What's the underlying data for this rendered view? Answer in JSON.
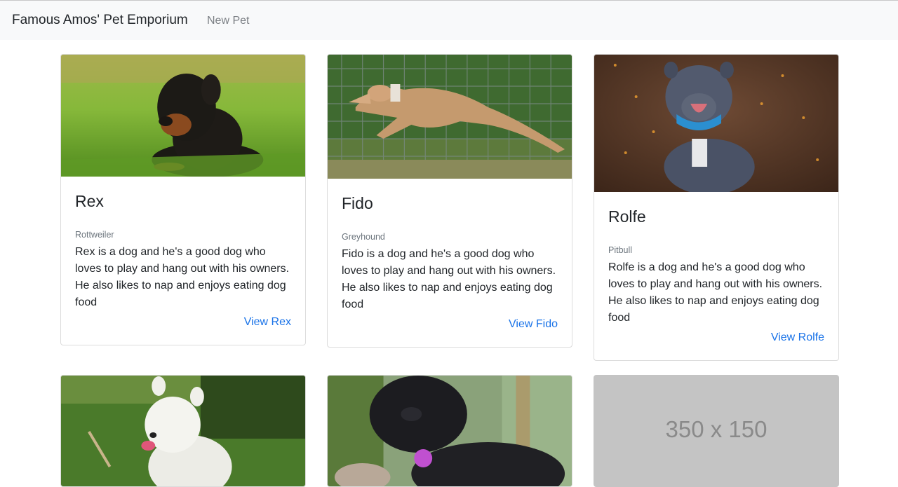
{
  "navbar": {
    "brand": "Famous Amos' Pet Emporium",
    "links": [
      "New Pet"
    ]
  },
  "pets": [
    {
      "name": "Rex",
      "breed": "Rottweiler",
      "description": "Rex is a dog and he's a good dog who loves to play and hang out with his owners. He also likes to nap and enjoys eating dog food",
      "link": "View Rex",
      "image": "rottweiler-puppy-on-grass"
    },
    {
      "name": "Fido",
      "breed": "Greyhound",
      "description": "Fido is a dog and he's a good dog who loves to play and hang out with his owners. He also likes to nap and enjoys eating dog food",
      "link": "View Fido",
      "image": "greyhound-leaping-by-fence"
    },
    {
      "name": "Rolfe",
      "breed": "Pitbull",
      "description": "Rolfe is a dog and he's a good dog who loves to play and hang out with his owners. He also likes to nap and enjoys eating dog food",
      "link": "View Rolfe",
      "image": "blue-pitbull-with-collar"
    }
  ],
  "row2": [
    {
      "image": "white-westie-on-grass"
    },
    {
      "image": "black-poodle-with-tag"
    },
    {
      "image": "placeholder",
      "placeholder_text": "350 x 150"
    }
  ],
  "colors": {
    "navbar_bg": "#f8f9fa",
    "link": "#1a73e8",
    "muted": "#6c757d",
    "placeholder_bg": "#c4c4c4"
  }
}
